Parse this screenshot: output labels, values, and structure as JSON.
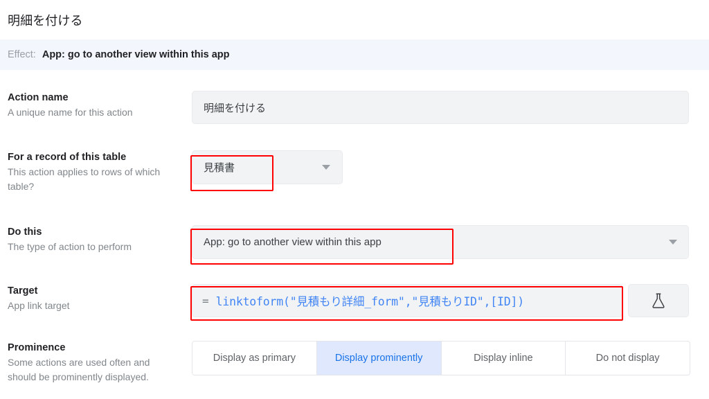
{
  "page": {
    "title": "明細を付ける"
  },
  "effect": {
    "label": "Effect:",
    "value": "App: go to another view within this app"
  },
  "fields": {
    "action_name": {
      "label": "Action name",
      "description": "A unique name for this action",
      "value": "明細を付ける"
    },
    "record_table": {
      "label": "For a record of this table",
      "description": "This action applies to rows of which table?",
      "value": "見積書",
      "dropdown_icon": "chevron-down-icon"
    },
    "do_this": {
      "label": "Do this",
      "description": "The type of action to perform",
      "value": "App: go to another view within this app",
      "dropdown_icon": "chevron-down-icon"
    },
    "target": {
      "label": "Target",
      "description": "App link target",
      "equals_sign": "=",
      "formula": "linktoform(\"見積もり詳細_form\",\"見積もりID\",[ID])",
      "test_icon": "flask-icon"
    },
    "prominence": {
      "label": "Prominence",
      "description": "Some actions are used often and should be prominently displayed.",
      "options": [
        {
          "label": "Display as primary",
          "selected": false
        },
        {
          "label": "Display prominently",
          "selected": true
        },
        {
          "label": "Display inline",
          "selected": false
        },
        {
          "label": "Do not display",
          "selected": false
        }
      ]
    }
  },
  "colors": {
    "accent_blue": "#1a73e8",
    "formula_blue": "#4285f4",
    "selected_bg": "#dfe8fc",
    "effect_bar_bg": "#f4f6fd",
    "input_bg": "#f1f3f4",
    "highlight_red": "#fe0000"
  }
}
